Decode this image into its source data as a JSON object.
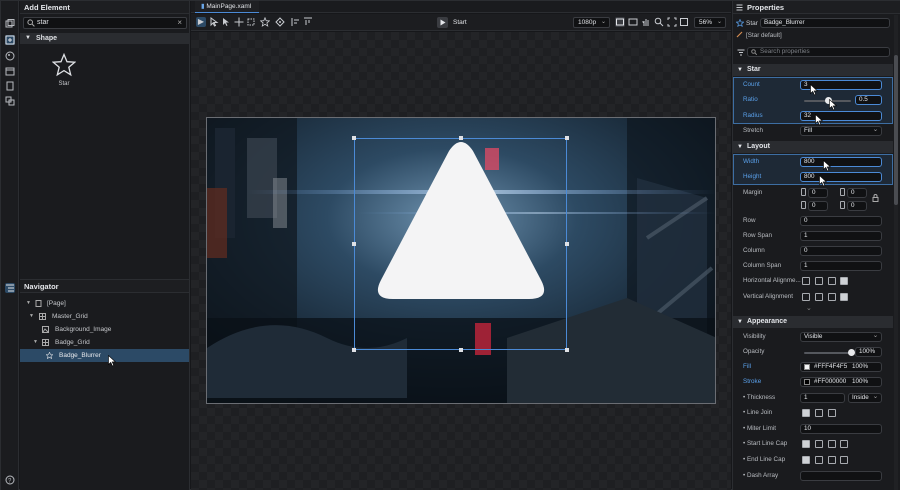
{
  "left_panel": {
    "title": "Add Element",
    "search_value": "star",
    "group": "Shape",
    "item_label": "Star"
  },
  "navigator": {
    "title": "Navigator",
    "items": [
      {
        "label": "[Page]"
      },
      {
        "label": "Master_Grid"
      },
      {
        "label": "Background_Image"
      },
      {
        "label": "Badge_Grid"
      },
      {
        "label": "Badge_Blurrer"
      }
    ]
  },
  "editor": {
    "tab_label": "MainPage.xaml",
    "start_label": "Start",
    "resolution": "1080p",
    "zoom": "56%"
  },
  "properties": {
    "title": "Properties",
    "element_type": "Star",
    "element_name": "Badge_Blurrer",
    "style": "[Star default]",
    "search_placeholder": "Search properties",
    "star_section": "Star",
    "count_label": "Count",
    "count_value": "3",
    "ratio_label": "Ratio",
    "ratio_value": "0.5",
    "ratio_level": 0.5,
    "radius_label": "Radius",
    "radius_value": "32",
    "stretch_label": "Stretch",
    "stretch_value": "Fill",
    "layout_section": "Layout",
    "width_label": "Width",
    "width_value": "800",
    "height_label": "Height",
    "height_value": "800",
    "margin_label": "Margin",
    "margin_values": [
      "0",
      "0",
      "0",
      "0"
    ],
    "row_label": "Row",
    "row_value": "0",
    "rowspan_label": "Row Span",
    "rowspan_value": "1",
    "column_label": "Column",
    "column_value": "0",
    "colspan_label": "Column Span",
    "colspan_value": "1",
    "halign_label": "Horizontal Alignme...",
    "valign_label": "Vertical Alignment",
    "appearance_section": "Appearance",
    "visibility_label": "Visibility",
    "visibility_value": "Visible",
    "opacity_label": "Opacity",
    "opacity_value": "100%",
    "opacity_level": 1.0,
    "fill_label": "Fill",
    "fill_value": "#FFF4F4F5",
    "fill_pct": "100%",
    "fill_color": "#F4F4F5",
    "stroke_label": "Stroke",
    "stroke_value": "#FF000000",
    "stroke_pct": "100%",
    "stroke_color": "#000000",
    "thickness_label": "• Thickness",
    "thickness_value": "1",
    "thickness_mode": "Inside",
    "linejoin_label": "• Line Join",
    "miter_label": "• Miter Limit",
    "miter_value": "10",
    "startcap_label": "• Start Line Cap",
    "endcap_label": "• End Line Cap",
    "dash_label": "• Dash Array"
  },
  "colors": {
    "accent": "#4B8AD6",
    "selection": "#2C4A66",
    "label_blue": "#5AA0EA"
  }
}
